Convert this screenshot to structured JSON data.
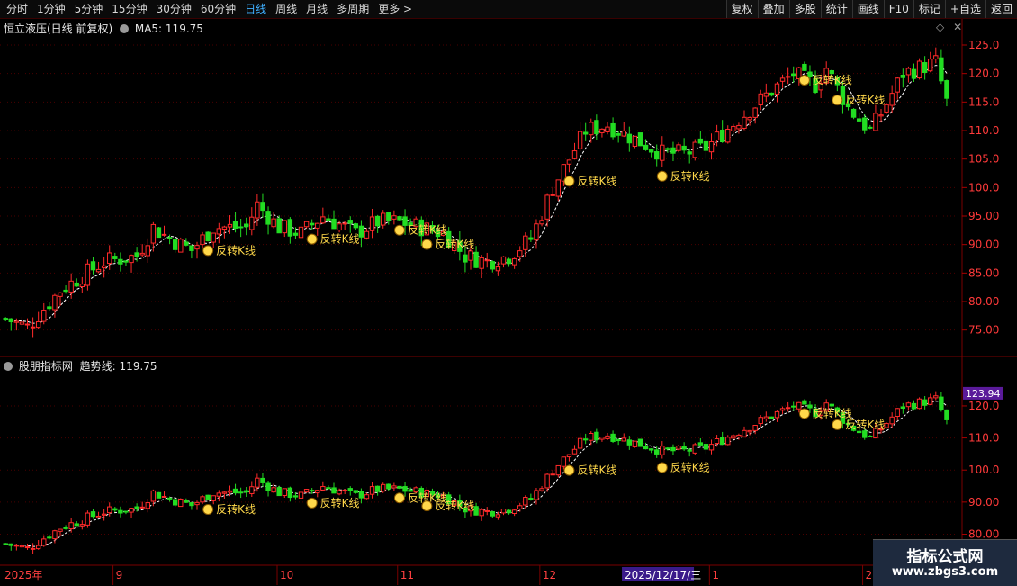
{
  "toolbar": {
    "periods": [
      "分时",
      "1分钟",
      "5分钟",
      "15分钟",
      "30分钟",
      "60分钟",
      "日线",
      "周线",
      "月线",
      "多周期",
      "更多"
    ],
    "active_period": "日线",
    "more_arrow": ">",
    "buttons": [
      "复权",
      "叠加",
      "多股",
      "统计",
      "画线",
      "F10",
      "标记",
      "+自选",
      "返回"
    ]
  },
  "main_panel": {
    "title": "恒立液压(日线 前复权)",
    "ma_label": "MA5:",
    "ma_value": "119.75",
    "y_ticks": [
      "125.0",
      "120.0",
      "115.0",
      "110.0",
      "105.0",
      "100.0",
      "95.00",
      "90.00",
      "85.00",
      "80.00",
      "75.00"
    ],
    "signal_label": "反转K线"
  },
  "sub_panel": {
    "title": "股朋指标网",
    "trend_label": "趋势线:",
    "trend_value": "119.75",
    "current_price_tag": "123.94",
    "y_ticks": [
      "120.0",
      "110.0",
      "100.0",
      "90.00",
      "80.00"
    ]
  },
  "x_axis": {
    "labels": [
      "2025年",
      "9",
      "10",
      "11",
      "12",
      "1",
      "2"
    ],
    "cursor_date": "2025/12/17/三"
  },
  "banner": {
    "title": "指标公式网",
    "url": "www.zbgs3.com"
  },
  "colors": {
    "up": "#ff2a2a",
    "down": "#22dd22",
    "signal": "#ffd84a",
    "ma_line": "#ffffff",
    "grid": "#4a0000"
  },
  "chart_data": {
    "type": "candlestick",
    "series_name": "MA5",
    "signals": [
      {
        "date_index": 37
      },
      {
        "date_index": 56
      },
      {
        "date_index": 72
      },
      {
        "date_index": 77
      },
      {
        "date_index": 103
      },
      {
        "date_index": 120
      },
      {
        "date_index": 146
      },
      {
        "date_index": 152
      }
    ]
  }
}
